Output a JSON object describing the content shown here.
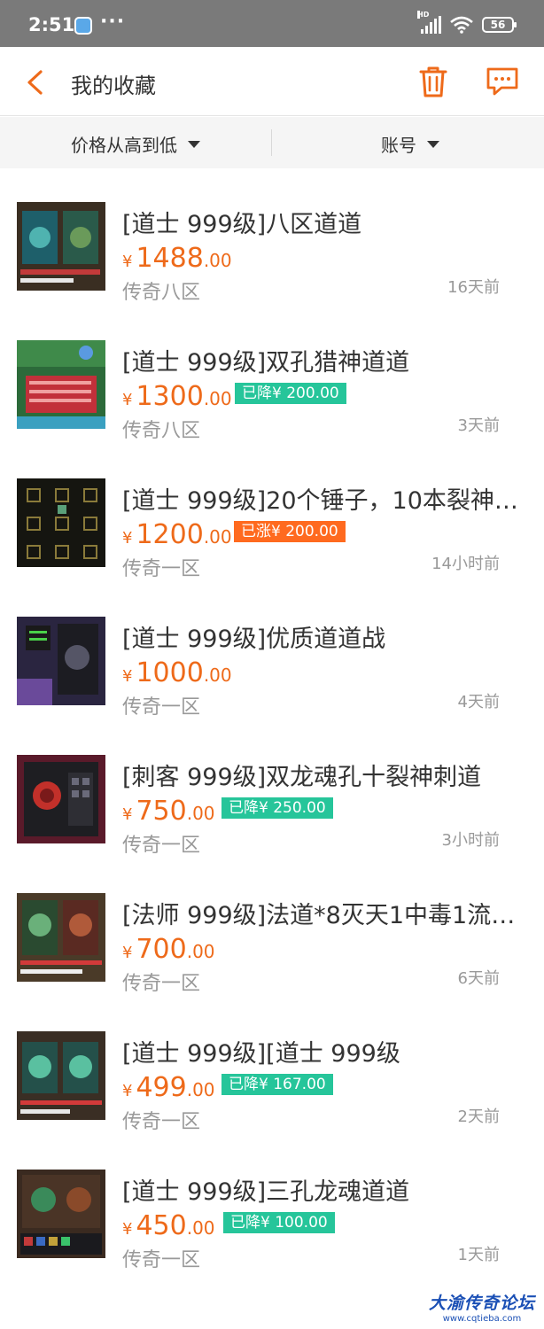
{
  "status_bar": {
    "time": "2:51",
    "dots": "···",
    "network_label": "HD",
    "battery": "56"
  },
  "header": {
    "title": "我的收藏"
  },
  "filters": {
    "sort_label": "价格从高到低",
    "account_label": "账号"
  },
  "currency_symbol": "¥",
  "items": [
    {
      "title": "[道士 999级]八区道道",
      "price_int": "1488",
      "price_dec": ".00",
      "tag": "",
      "tag_type": "",
      "server": "传奇八区",
      "time": "16天前"
    },
    {
      "title": "[道士 999级]双孔猎神道道",
      "price_int": "1300",
      "price_dec": ".00",
      "tag": "已降¥ 200.00",
      "tag_type": "drop",
      "server": "传奇八区",
      "time": "3天前"
    },
    {
      "title": "[道士 999级]20个锤子，10本裂神…",
      "price_int": "1200",
      "price_dec": ".00",
      "tag": "已涨¥ 200.00",
      "tag_type": "rise",
      "server": "传奇一区",
      "time": "14小时前"
    },
    {
      "title": "[道士 999级]优质道道战",
      "price_int": "1000",
      "price_dec": ".00",
      "tag": "",
      "tag_type": "",
      "server": "传奇一区",
      "time": "4天前"
    },
    {
      "title": "[刺客 999级]双龙魂孔十裂神刺道",
      "price_int": "750",
      "price_dec": ".00",
      "tag": "已降¥ 250.00",
      "tag_type": "drop",
      "server": "传奇一区",
      "time": "3小时前"
    },
    {
      "title": "[法师 999级]法道*8灭天1中毒1流…",
      "price_int": "700",
      "price_dec": ".00",
      "tag": "",
      "tag_type": "",
      "server": "传奇一区",
      "time": "6天前"
    },
    {
      "title": "[道士 999级][道士 999级",
      "price_int": "499",
      "price_dec": ".00",
      "tag": "已降¥ 167.00",
      "tag_type": "drop",
      "server": "传奇一区",
      "time": "2天前"
    },
    {
      "title": "[道士 999级]三孔龙魂道道",
      "price_int": "450",
      "price_dec": ".00",
      "tag": "已降¥ 100.00",
      "tag_type": "drop",
      "server": "传奇一区",
      "time": "1天前"
    }
  ],
  "colors": {
    "accent": "#ee6a1a",
    "drop_tag": "#26c59a",
    "rise_tag": "#ff6a1f",
    "status_bar": "#7a7a7a"
  },
  "watermark": {
    "text": "大渝传奇论坛",
    "url": "www.cqtieba.com"
  }
}
